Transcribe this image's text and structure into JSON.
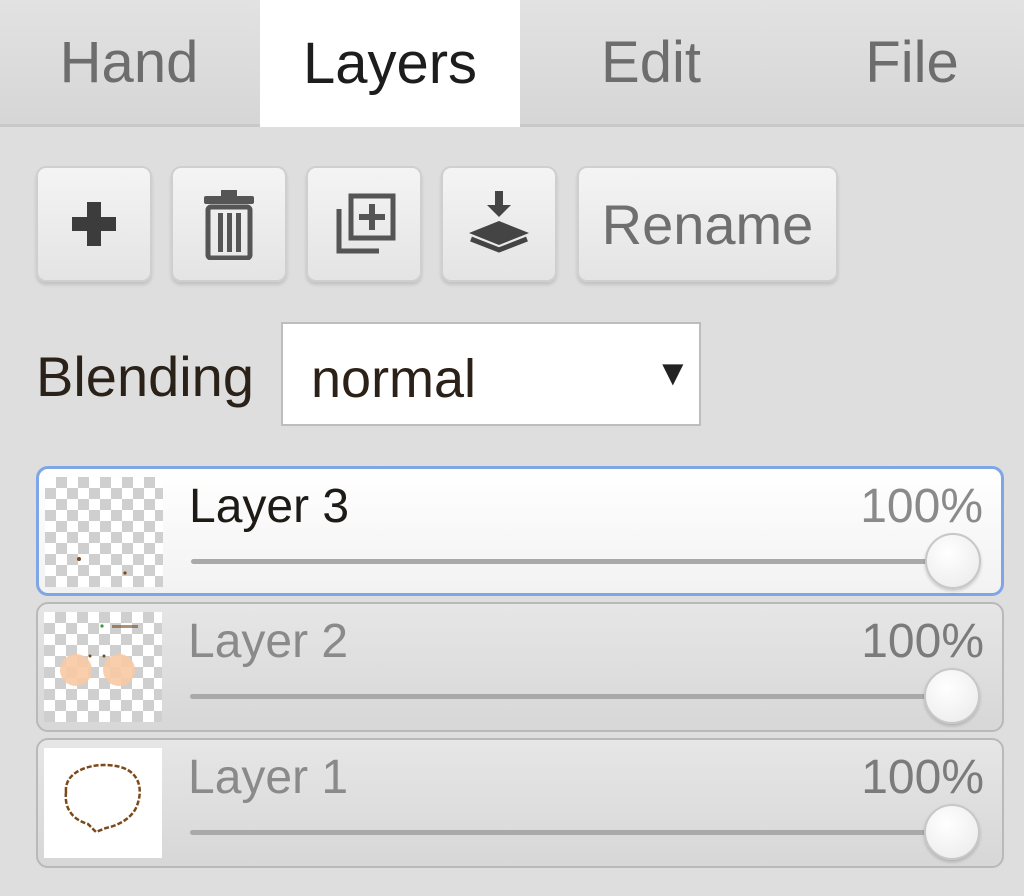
{
  "tabs": [
    {
      "label": "Hand",
      "active": false
    },
    {
      "label": "Layers",
      "active": true
    },
    {
      "label": "Edit",
      "active": false
    },
    {
      "label": "File",
      "active": false
    }
  ],
  "toolbar": {
    "add_icon": "plus-icon",
    "delete_icon": "trash-icon",
    "duplicate_icon": "duplicate-layer-icon",
    "merge_down_icon": "merge-down-icon",
    "rename_label": "Rename"
  },
  "blending": {
    "label": "Blending",
    "value": "normal",
    "arrow": "▼"
  },
  "layers": [
    {
      "name": "Layer 3",
      "opacity_label": "100%",
      "opacity": 1.0,
      "selected": true
    },
    {
      "name": "Layer 2",
      "opacity_label": "100%",
      "opacity": 1.0,
      "selected": false
    },
    {
      "name": "Layer 1",
      "opacity_label": "100%",
      "opacity": 1.0,
      "selected": false
    }
  ],
  "colors": {
    "selected_border": "#7ea6e6",
    "thumb_stroke": "#7a4a1a",
    "thumb_peach": "#f7c9a3"
  }
}
